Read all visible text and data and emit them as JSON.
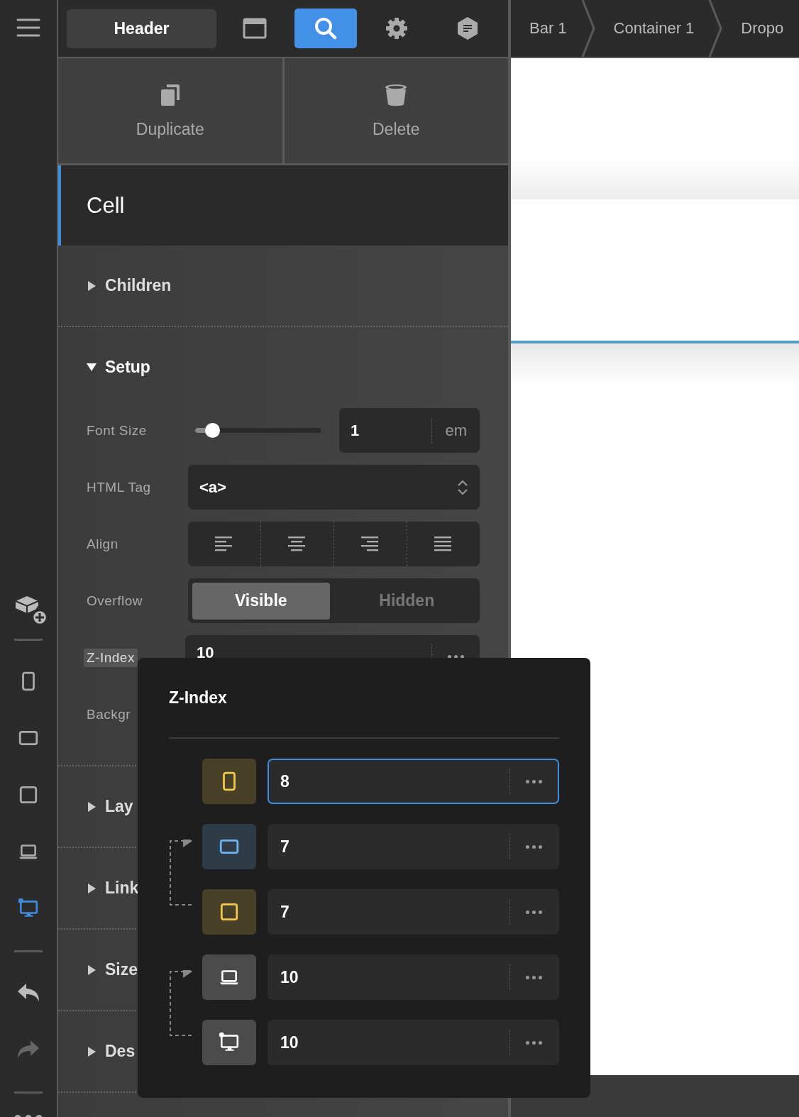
{
  "rail": {
    "devices": [
      {
        "kind": "phone",
        "selected": false
      },
      {
        "kind": "tablet-landscape",
        "selected": false
      },
      {
        "kind": "tablet",
        "selected": false
      },
      {
        "kind": "laptop",
        "selected": false
      },
      {
        "kind": "desktop",
        "selected": true
      }
    ],
    "undo": {
      "disabled": false
    },
    "redo": {
      "disabled": true
    }
  },
  "toolbar": {
    "title_button": "Header",
    "tools": [
      {
        "kind": "window",
        "selected": false
      },
      {
        "kind": "search",
        "selected": true
      },
      {
        "kind": "settings",
        "selected": false
      },
      {
        "kind": "notes",
        "selected": false
      }
    ]
  },
  "breadcrumbs": [
    "Bar 1",
    "Container 1",
    "Dropo"
  ],
  "actions": [
    {
      "kind": "duplicate",
      "label": "Duplicate"
    },
    {
      "kind": "delete",
      "label": "Delete"
    }
  ],
  "element_title": "Cell",
  "sections": [
    {
      "title": "Children",
      "expanded": false
    },
    {
      "title": "Setup",
      "expanded": true,
      "fields": [
        {
          "kind": "slider",
          "label": "Font Size",
          "level": 0.14,
          "value": "1",
          "unit": "em"
        },
        {
          "kind": "select",
          "label": "HTML Tag",
          "value": "<a>"
        },
        {
          "kind": "align",
          "label": "Align",
          "options": [
            {
              "kind": "left",
              "selected": false
            },
            {
              "kind": "center",
              "selected": false
            },
            {
              "kind": "right",
              "selected": false
            },
            {
              "kind": "justify",
              "selected": false
            }
          ]
        },
        {
          "kind": "segmented",
          "label": "Overflow",
          "options": [
            {
              "label": "Visible",
              "selected": true
            },
            {
              "label": "Hidden",
              "selected": false
            }
          ]
        },
        {
          "kind": "number",
          "label": "Z-Index",
          "value": "10",
          "highlighted": true
        },
        {
          "kind": "label",
          "label": "Backgr"
        }
      ]
    },
    {
      "title": "Lay",
      "expanded": false
    },
    {
      "title": "Link",
      "expanded": false
    },
    {
      "title": "Size",
      "expanded": false
    },
    {
      "title": "Des",
      "expanded": false
    }
  ],
  "popup": {
    "title": "Z-Index",
    "rows": [
      {
        "kind": "phone",
        "color": "#f2c94c",
        "value": "8",
        "focused": true,
        "linked": false
      },
      {
        "kind": "tablet-landscape",
        "color": "#6cb4f2",
        "value": "7",
        "focused": false,
        "linked": true
      },
      {
        "kind": "tablet",
        "color": "#f2c94c",
        "value": "7",
        "focused": false,
        "linked": false
      },
      {
        "kind": "laptop",
        "color": "#ffffff",
        "value": "10",
        "focused": false,
        "linked": true
      },
      {
        "kind": "desktop",
        "color": "#ffffff",
        "value": "10",
        "focused": false,
        "linked": false
      }
    ]
  }
}
